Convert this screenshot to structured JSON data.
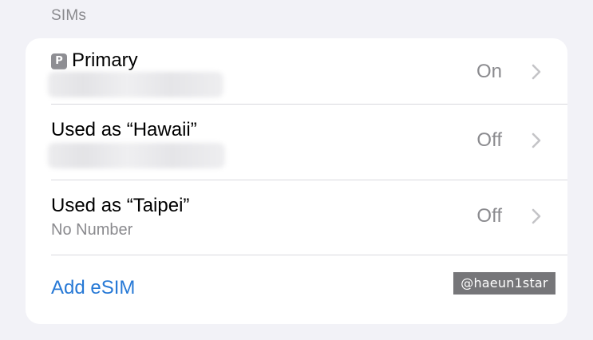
{
  "section": {
    "title": "SIMs"
  },
  "sims": [
    {
      "badge": "P",
      "label": "Primary",
      "subtitle": "",
      "status": "On"
    },
    {
      "badge": "",
      "label": "Used as “Hawaii”",
      "subtitle": "",
      "status": "Off"
    },
    {
      "badge": "",
      "label": "Used as “Taipei”",
      "subtitle": "No Number",
      "status": "Off"
    }
  ],
  "add_esim": {
    "label": "Add eSIM"
  },
  "watermark": {
    "text": "@haeun1star"
  },
  "icons": {
    "chevron": "chevron-right-icon",
    "badge": "primary-badge-icon"
  },
  "colors": {
    "background": "#f2f2f7",
    "card": "#ffffff",
    "link": "#2779d6",
    "secondary": "#8a8a8e",
    "watermark_bg": "#767679"
  }
}
